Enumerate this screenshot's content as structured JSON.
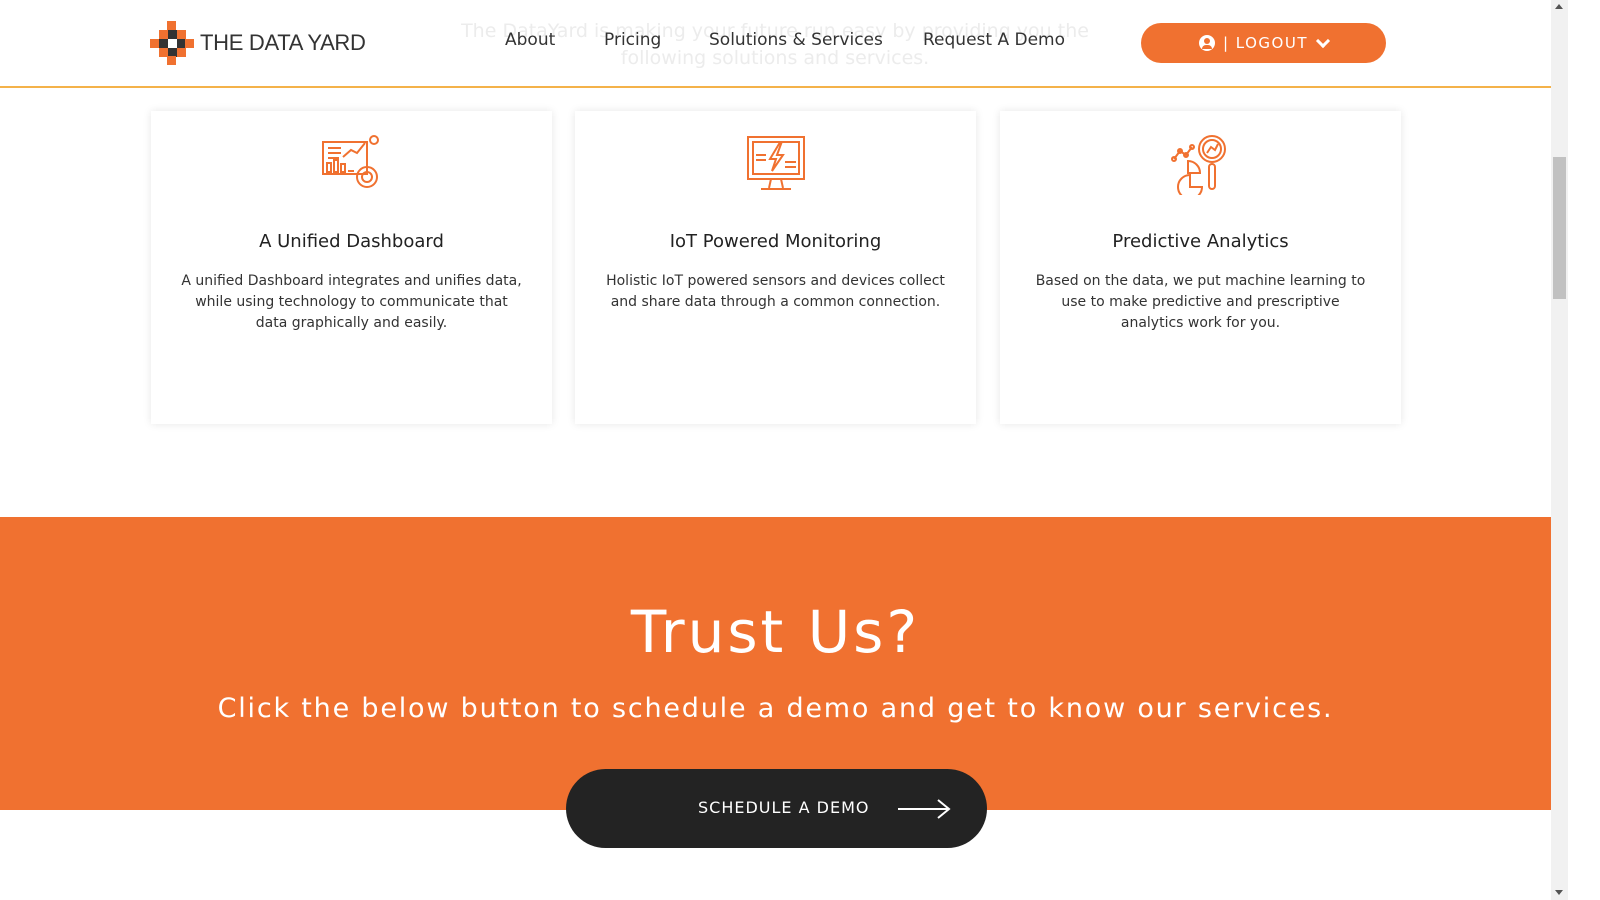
{
  "intro_faded": "The DataYard is making your future run easy by providing you the following solutions and services.",
  "header": {
    "logo_text": "THE DATA YARD",
    "nav": [
      {
        "label": "About"
      },
      {
        "label": "Pricing"
      },
      {
        "label": "Solutions & Services"
      },
      {
        "label": "Request A Demo"
      }
    ],
    "logout_label": "| LOGOUT",
    "icons": {
      "user": "user-circle-icon",
      "chevron": "chevron-down-icon"
    }
  },
  "cards": [
    {
      "title": "A Unified Dashboard",
      "description": "A unified Dashboard integrates and unifies data, while using technology to communicate that data graphically and easily.",
      "icon": "dashboard-chart-icon"
    },
    {
      "title": "IoT Powered Monitoring",
      "description": "Holistic IoT powered sensors and devices collect and share data through a common connection.",
      "icon": "monitor-lightning-icon"
    },
    {
      "title": "Predictive Analytics",
      "description": "Based on the data, we put machine learning to use to make predictive and prescriptive analytics work for you.",
      "icon": "analytics-magnifier-icon"
    }
  ],
  "cta": {
    "title": "Trust Us?",
    "subtitle": "Click the below button to schedule a demo and get to know our services.",
    "button_label": "SCHEDULE A DEMO",
    "button_icon": "arrow-right-icon"
  },
  "colors": {
    "accent": "#f07130",
    "header_border": "#f4b24a",
    "dark_button": "#232323"
  }
}
